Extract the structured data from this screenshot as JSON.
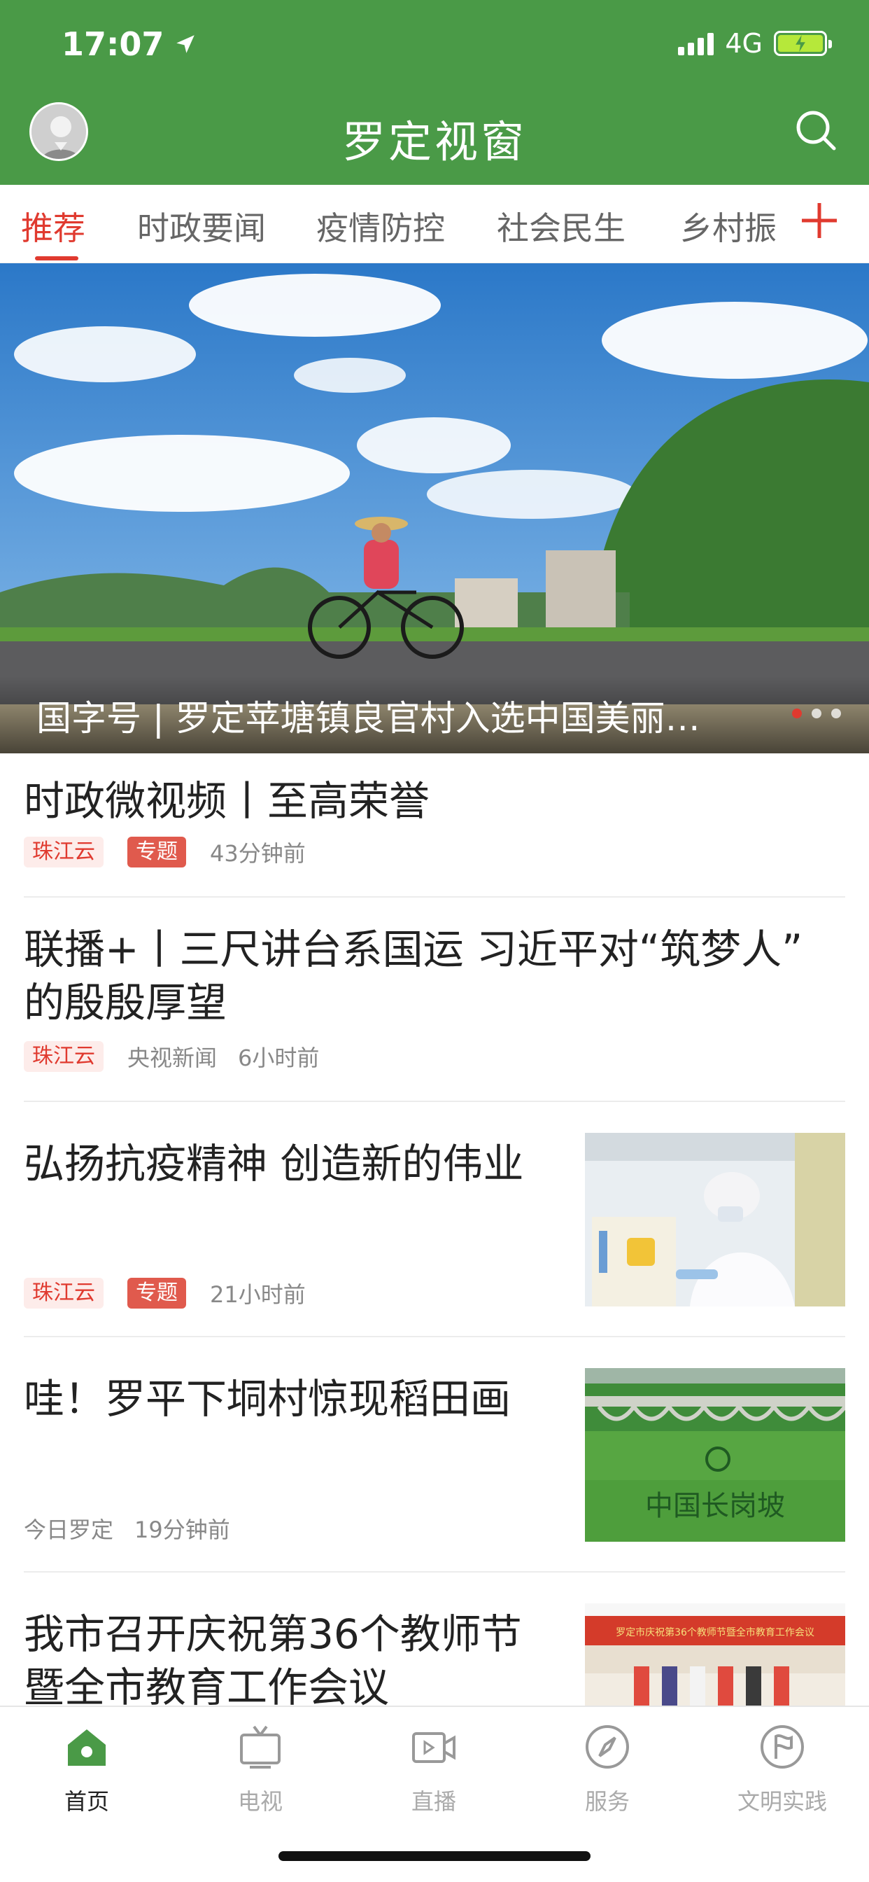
{
  "status_bar": {
    "time": "17:07",
    "network": "4G"
  },
  "header": {
    "title": "罗定视窗"
  },
  "tabs": [
    {
      "label": "推荐",
      "active": true
    },
    {
      "label": "时政要闻",
      "active": false
    },
    {
      "label": "疫情防控",
      "active": false
    },
    {
      "label": "社会民生",
      "active": false
    },
    {
      "label": "乡村振",
      "active": false
    }
  ],
  "banner": {
    "caption": "国字号 | 罗定苹塘镇良官村入选中国美丽…",
    "dot_count": 3,
    "active_dot": 0
  },
  "news": [
    {
      "title": "时政微视频丨至高荣誉",
      "source": "珠江云",
      "badge": "专题",
      "time": "43分钟前"
    },
    {
      "title_line1": "联播+丨三尺讲台系国运 习近平对“筑梦人”",
      "title_line2": "的殷殷厚望",
      "source": "珠江云",
      "extra_source": "央视新闻",
      "time": "6小时前"
    },
    {
      "title": "弘扬抗疫精神 创造新的伟业",
      "source": "珠江云",
      "badge": "专题",
      "time": "21小时前",
      "image": "lab-worker-photo"
    },
    {
      "title": "哇！罗平下垌村惊现稻田画",
      "source": "今日罗定",
      "time": "19分钟前",
      "image": "rice-field-art-photo",
      "image_text": "中国长岗坡"
    },
    {
      "title_line1": "我市召开庆祝第36个教师节",
      "title_line2": "暨全市教育工作会议",
      "image": "meeting-photo",
      "image_text": "罗定市庆祝第36个教师节暨全市教育工作会议"
    }
  ],
  "bottom_nav": [
    {
      "label": "首页",
      "icon": "home-icon",
      "active": true
    },
    {
      "label": "电视",
      "icon": "tv-icon",
      "active": false
    },
    {
      "label": "直播",
      "icon": "live-video-icon",
      "active": false
    },
    {
      "label": "服务",
      "icon": "compass-icon",
      "active": false
    },
    {
      "label": "文明实践",
      "icon": "flag-circle-icon",
      "active": false
    }
  ],
  "colors": {
    "header_green": "#4a9a47",
    "accent_red": "#e03a2f"
  }
}
